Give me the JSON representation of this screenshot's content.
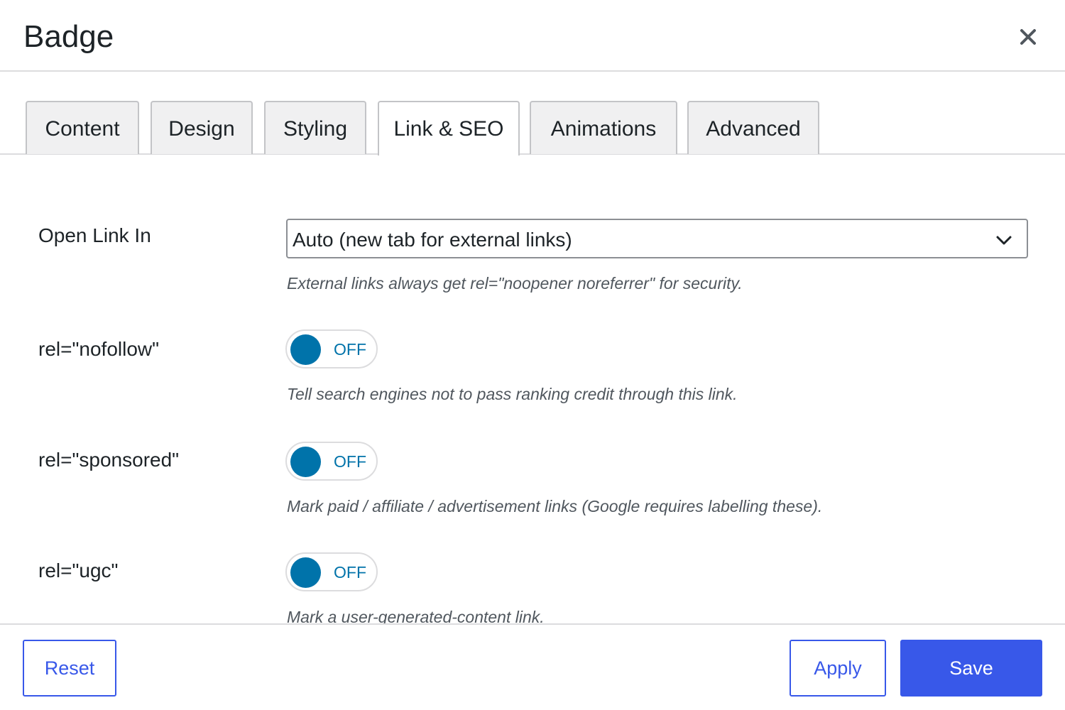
{
  "dialog": {
    "title": "Badge",
    "close_icon": "close-icon"
  },
  "tabs": [
    {
      "label": "Content",
      "active": false
    },
    {
      "label": "Design",
      "active": false
    },
    {
      "label": "Styling",
      "active": false
    },
    {
      "label": "Link & SEO",
      "active": true
    },
    {
      "label": "Animations",
      "active": false
    },
    {
      "label": "Advanced",
      "active": false
    }
  ],
  "fields": {
    "open_link_in": {
      "label": "Open Link In",
      "value": "Auto (new tab for external links)",
      "help": "External links always get rel=\"noopener noreferrer\" for security.",
      "icon": "chevron-down-icon"
    },
    "nofollow": {
      "label": "rel=\"nofollow\"",
      "state": "OFF",
      "help": "Tell search engines not to pass ranking credit through this link."
    },
    "sponsored": {
      "label": "rel=\"sponsored\"",
      "state": "OFF",
      "help": "Mark paid / affiliate / advertisement links (Google requires labelling these)."
    },
    "ugc": {
      "label": "rel=\"ugc\"",
      "state": "OFF",
      "help": "Mark a user-generated-content link."
    }
  },
  "footer": {
    "reset_label": "Reset",
    "apply_label": "Apply",
    "save_label": "Save"
  },
  "colors": {
    "accent": "#3858e9",
    "toggle": "#0073aa",
    "border": "#dcdcde",
    "tab_inactive_bg": "#f0f0f1"
  }
}
